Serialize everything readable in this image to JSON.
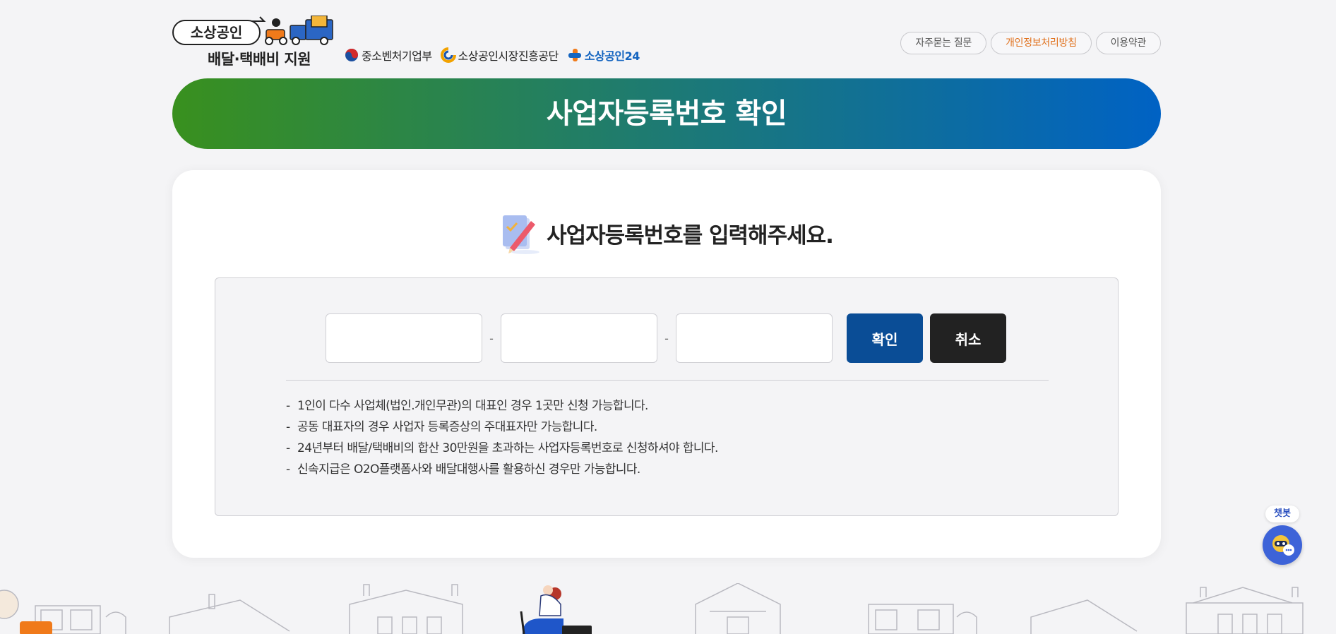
{
  "logo": {
    "pill_text": "소상공인",
    "sub_text": "배달·택배비 지원"
  },
  "orgs": [
    {
      "label": "중소벤처기업부"
    },
    {
      "label": "소상공인시장진흥공단"
    },
    {
      "label": "소상공인24"
    }
  ],
  "topnav": {
    "faq": "자주묻는 질문",
    "privacy": "개인정보처리방침",
    "terms": "이용약관"
  },
  "banner": {
    "title": "사업자등록번호 확인"
  },
  "form": {
    "heading": "사업자등록번호를 입력해주세요.",
    "field1_value": "",
    "field2_value": "",
    "field3_value": "",
    "separator": "-",
    "confirm_label": "확인",
    "cancel_label": "취소",
    "notes": [
      "1인이 다수 사업체(법인.개인무관)의 대표인 경우 1곳만 신청 가능합니다.",
      "공동 대표자의 경우 사업자 등록증상의 주대표자만 가능합니다.",
      "24년부터 배달/택배비의 합산 30만원을 초과하는 사업자등록번호로 신청하셔야 합니다.",
      "신속지급은 O2O플랫폼사와 배달대행사를 활용하신 경우만 가능합니다."
    ]
  },
  "chatbot": {
    "label": "챗봇"
  },
  "colors": {
    "banner_start": "#39901e",
    "banner_end": "#0062c4",
    "confirm_button": "#0a4d96",
    "cancel_button": "#222222",
    "privacy_link": "#e0711d",
    "chatbot": "#3d63d8"
  }
}
